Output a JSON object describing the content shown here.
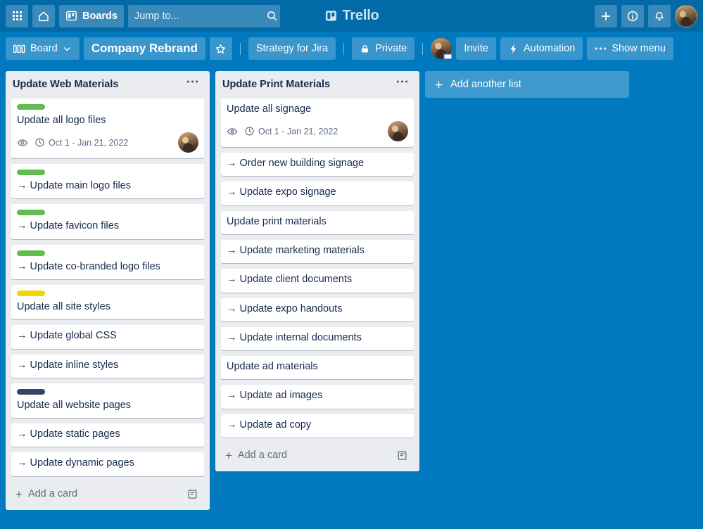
{
  "topnav": {
    "apps_icon": "grid-apps-icon",
    "home_icon": "home-icon",
    "boards_label": "Boards",
    "boards_icon": "board-icon",
    "search_placeholder": "Jump to...",
    "search_value": "",
    "search_icon": "search-icon",
    "brand_label": "Trello",
    "brand_icon": "trello-logo-icon",
    "add_icon": "plus-icon",
    "info_icon": "info-circle-icon",
    "notifications_icon": "bell-icon",
    "avatar": "user-avatar"
  },
  "boardheader": {
    "view_label": "Board",
    "view_icon": "board-columns-icon",
    "view_chevron": "chevron-down-icon",
    "board_title": "Company Rebrand",
    "star_icon": "star-icon",
    "team_label": "Strategy for Jira",
    "visibility_label": "Private",
    "visibility_icon": "lock-icon",
    "member_avatar": "member-avatar",
    "invite_label": "Invite",
    "automation_label": "Automation",
    "automation_icon": "bolt-icon",
    "menu_label": "Show menu",
    "menu_icon": "ellipsis-icon"
  },
  "colors": {
    "nav_bg": "#026aa7",
    "board_bg": "#0079bf",
    "list_bg": "#ebecf0",
    "card_bg": "#ffffff",
    "text": "#172b4d",
    "subtle_text": "#5e6c84",
    "label_green": "#61bd4f",
    "label_yellow": "#f2d600",
    "label_navy": "#344563"
  },
  "lists": [
    {
      "title": "Update Web Materials",
      "menu_icon": "ellipsis-icon",
      "add_card_label": "Add a card",
      "add_card_icon": "plus-icon",
      "template_icon": "card-template-icon",
      "cards": [
        {
          "title": "Update all logo files",
          "label_color": "#61bd4f",
          "watch_icon": "eye-icon",
          "due_icon": "clock-icon",
          "due_text": "Oct 1 - Jan 21, 2022",
          "member": "member-avatar"
        },
        {
          "title": "→ Update main logo files",
          "label_color": "#61bd4f"
        },
        {
          "title": "→ Update favicon files",
          "label_color": "#61bd4f"
        },
        {
          "title": "→ Update co-branded logo files",
          "label_color": "#61bd4f"
        },
        {
          "title": "Update all site styles",
          "label_color": "#f2d600"
        },
        {
          "title": "→ Update global CSS"
        },
        {
          "title": "→ Update inline styles"
        },
        {
          "title": "Update all website pages",
          "label_color": "#344563"
        },
        {
          "title": "→ Update static pages"
        },
        {
          "title": "→ Update dynamic pages"
        }
      ]
    },
    {
      "title": "Update Print Materials",
      "menu_icon": "ellipsis-icon",
      "add_card_label": "Add a card",
      "add_card_icon": "plus-icon",
      "template_icon": "card-template-icon",
      "cards": [
        {
          "title": "Update all signage",
          "watch_icon": "eye-icon",
          "due_icon": "clock-icon",
          "due_text": "Oct 1 - Jan 21, 2022",
          "member": "member-avatar"
        },
        {
          "title": "→ Order new building signage"
        },
        {
          "title": "→ Update expo signage"
        },
        {
          "title": "Update print materials"
        },
        {
          "title": "→ Update marketing materials"
        },
        {
          "title": "→ Update client documents"
        },
        {
          "title": "→ Update expo handouts"
        },
        {
          "title": "→ Update internal documents"
        },
        {
          "title": "Update ad materials"
        },
        {
          "title": "→ Update ad images"
        },
        {
          "title": "→ Update ad copy"
        }
      ]
    }
  ],
  "add_list": {
    "label": "Add another list",
    "icon": "plus-icon"
  }
}
